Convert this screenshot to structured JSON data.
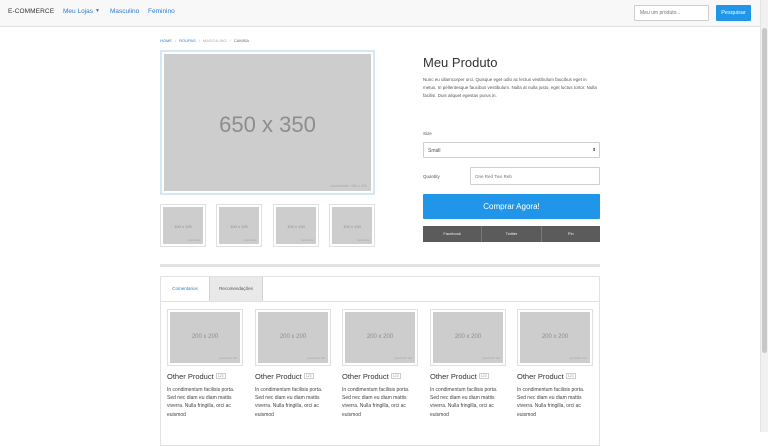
{
  "navbar": {
    "brand": "E-COMMERCE",
    "links": [
      {
        "label": "Meu Lojas",
        "has_caret": true
      },
      {
        "label": "Masculino"
      },
      {
        "label": "Feminino"
      }
    ],
    "caret_icon": "▼",
    "search_placeholder": "Meu um produto...",
    "search_button": "Pesquisar"
  },
  "breadcrumb": [
    "HOME",
    "ROUPAS",
    "MASCULINO",
    "CAMISA"
  ],
  "main_image": {
    "text": "650 x 350",
    "credit": "placeholder / 650 x 350"
  },
  "thumbnails": [
    {
      "text": "100 x 100",
      "credit": "placeholder"
    },
    {
      "text": "100 x 100",
      "credit": "placeholder"
    },
    {
      "text": "100 x 100",
      "credit": "placeholder"
    },
    {
      "text": "100 x 100",
      "credit": "placeholder"
    }
  ],
  "product": {
    "title": "Meu Produto",
    "description": "Nunc eu ullamcorper orci. Quisque eget odio ac lectus vestibulum faucibus eget in metus. In pellentesque faucibus vestibulum. Nulla at nulla justo, eget luctus tortor. Nulla facilisi. Duis aliquet egestas purus in.",
    "size_label": "Size",
    "size_value": "Small",
    "select_arrow": "⬍",
    "quantity_label": "Quantity",
    "quantity_placeholder": "One Red Two Reb",
    "buy_button": "Comprar Agora!",
    "share_buttons": [
      "Facebook",
      "Twitter",
      "Pin"
    ]
  },
  "tabs": [
    {
      "label": "Comentarios",
      "active": false
    },
    {
      "label": "Recomendações",
      "active": true
    }
  ],
  "cards": [
    {
      "img_text": "200 x 200",
      "credit": "placeholder 200",
      "title": "Other Product",
      "badge": "123",
      "text": "In condimentum facilisis porta. Sed nec diam eu diam mattis viverra. Nulla fringilla, orci ac euismod"
    },
    {
      "img_text": "200 x 200",
      "credit": "placeholder 200",
      "title": "Other Product",
      "badge": "123",
      "text": "In condimentum facilisis porta. Sed nec diam eu diam mattis viverra. Nulla fringilla, orci ac euismod"
    },
    {
      "img_text": "200 x 200",
      "credit": "placeholder 200",
      "title": "Other Product",
      "badge": "123",
      "text": "In condimentum facilisis porta. Sed nec diam eu diam mattis viverra. Nulla fringilla, orci ac euismod"
    },
    {
      "img_text": "200 x 200",
      "credit": "placeholder 200",
      "title": "Other Product",
      "badge": "123",
      "text": "In condimentum facilisis porta. Sed nec diam eu diam mattis viverra. Nulla fringilla, orci ac euismod"
    },
    {
      "img_text": "200 x 200",
      "credit": "placeholder 200",
      "title": "Other Product",
      "badge": "123",
      "text": "In condimentum facilisis porta. Sed nec diam eu diam mattis viverra. Nulla fringilla, orci ac euismod"
    }
  ],
  "colors": {
    "accent": "#2196e8",
    "link": "#2b7cd0",
    "placeholder": "#cdcdcd",
    "share": "#5b5b5b"
  }
}
